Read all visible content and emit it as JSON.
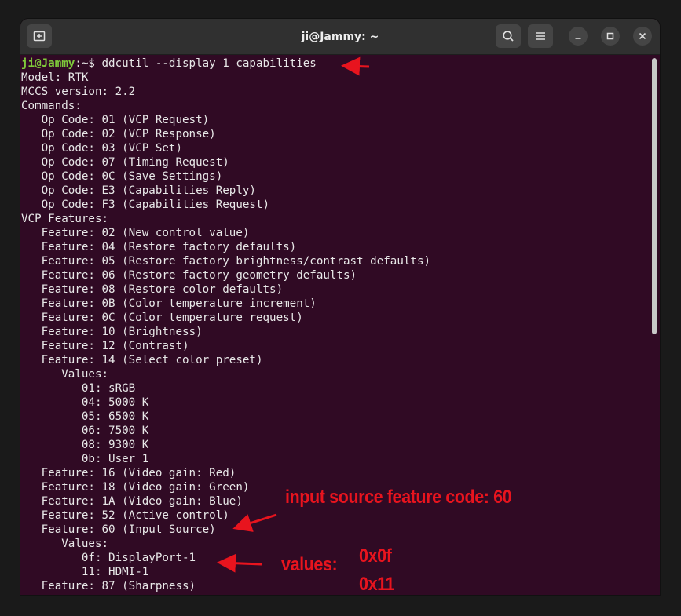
{
  "window": {
    "title": "ji@Jammy: ~"
  },
  "prompt": {
    "user_host": "ji@Jammy",
    "path_symbol": ":~$",
    "command": "ddcutil --display 1 capabilities"
  },
  "output": [
    "Model: RTK",
    "MCCS version: 2.2",
    "Commands:",
    "   Op Code: 01 (VCP Request)",
    "   Op Code: 02 (VCP Response)",
    "   Op Code: 03 (VCP Set)",
    "   Op Code: 07 (Timing Request)",
    "   Op Code: 0C (Save Settings)",
    "   Op Code: E3 (Capabilities Reply)",
    "   Op Code: F3 (Capabilities Request)",
    "VCP Features:",
    "   Feature: 02 (New control value)",
    "   Feature: 04 (Restore factory defaults)",
    "   Feature: 05 (Restore factory brightness/contrast defaults)",
    "   Feature: 06 (Restore factory geometry defaults)",
    "   Feature: 08 (Restore color defaults)",
    "   Feature: 0B (Color temperature increment)",
    "   Feature: 0C (Color temperature request)",
    "   Feature: 10 (Brightness)",
    "   Feature: 12 (Contrast)",
    "   Feature: 14 (Select color preset)",
    "      Values:",
    "         01: sRGB",
    "         04: 5000 K",
    "         05: 6500 K",
    "         06: 7500 K",
    "         08: 9300 K",
    "         0b: User 1",
    "   Feature: 16 (Video gain: Red)",
    "   Feature: 18 (Video gain: Green)",
    "   Feature: 1A (Video gain: Blue)",
    "   Feature: 52 (Active control)",
    "   Feature: 60 (Input Source)",
    "      Values:",
    "         0f: DisplayPort-1",
    "         11: HDMI-1",
    "   Feature: 87 (Sharpness)"
  ],
  "annotations": {
    "input_source": "input source feature code: 60",
    "values_label": "values:",
    "value_1": "0x0f",
    "value_2": "0x11",
    "color": "#e8141e"
  },
  "icons": {
    "new_tab": "new-tab-icon",
    "search": "search-icon",
    "menu": "hamburger-menu-icon",
    "minimize": "minimize-icon",
    "maximize": "maximize-icon",
    "close": "close-icon"
  }
}
